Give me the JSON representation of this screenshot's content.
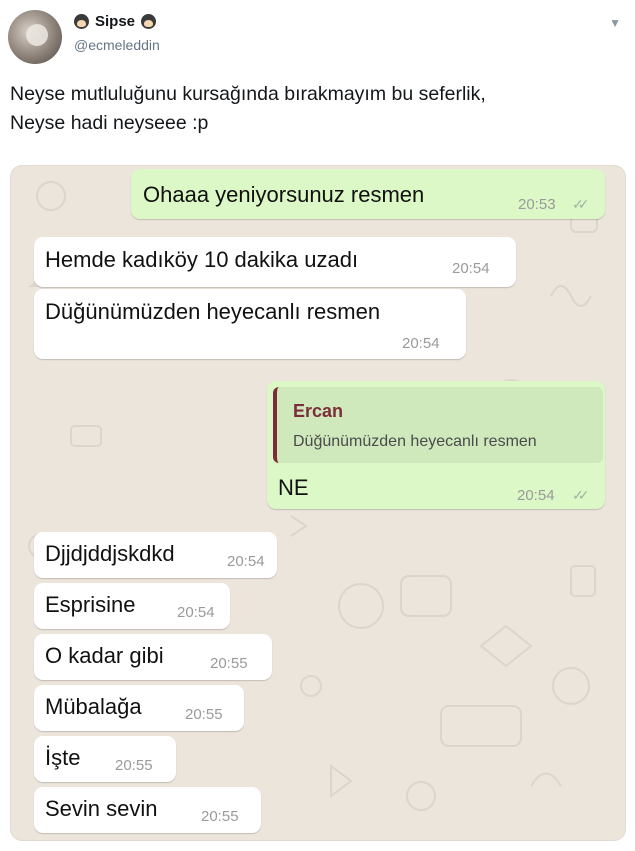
{
  "tweet": {
    "display_name": "Sipse",
    "handle": "@ecmeleddin",
    "text_line1": "Neyse mutluluğunu kursağında bırakmayım bu seferlik,",
    "text_line2": "Neyse hadi neyseee :p"
  },
  "chat": {
    "messages": [
      {
        "text": "Ohaaa yeniyorsunuz resmen",
        "time": "20:53",
        "ticks": "✓✓"
      },
      {
        "text": "Hemde kadıköy 10 dakika uzadı",
        "time": "20:54"
      },
      {
        "text": "Düğünümüzden heyecanlı resmen",
        "time": "20:54"
      },
      {
        "quote_name": "Ercan",
        "quote_text": "Düğünümüzden heyecanlı resmen",
        "text": "NE",
        "time": "20:54",
        "ticks": "✓✓"
      },
      {
        "text": "Djjdjddjskdkd",
        "time": "20:54"
      },
      {
        "text": "Esprisine",
        "time": "20:54"
      },
      {
        "text": "O kadar gibi",
        "time": "20:55"
      },
      {
        "text": "Mübalağa",
        "time": "20:55"
      },
      {
        "text": "İşte",
        "time": "20:55"
      },
      {
        "text": "Sevin sevin",
        "time": "20:55"
      }
    ]
  }
}
